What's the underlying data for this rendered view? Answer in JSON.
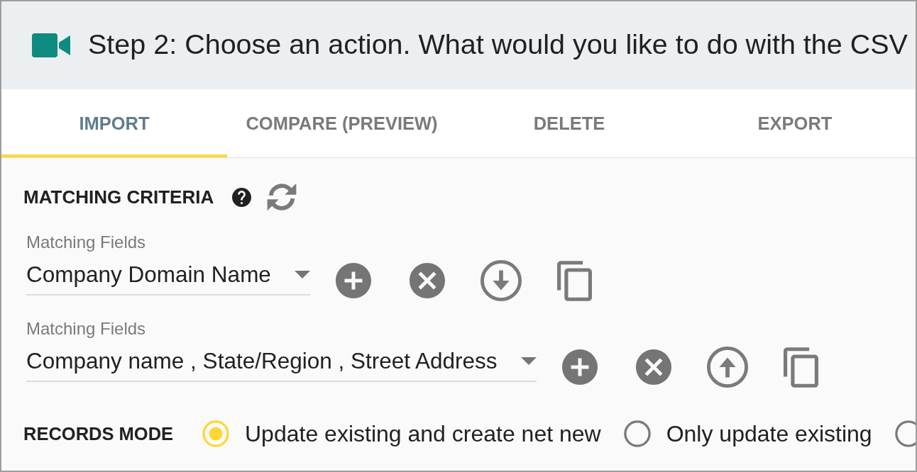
{
  "header": {
    "title": "Step 2: Choose an action. What would you like to do with the CSV"
  },
  "tabs": [
    {
      "label": "IMPORT",
      "selected": true
    },
    {
      "label": "COMPARE (PREVIEW)",
      "selected": false
    },
    {
      "label": "DELETE",
      "selected": false
    },
    {
      "label": "EXPORT",
      "selected": false
    }
  ],
  "matching_criteria": {
    "title": "MATCHING CRITERIA",
    "rules": [
      {
        "label": "Matching Fields",
        "value": "Company Domain Name",
        "kind": "down"
      },
      {
        "label": "Matching Fields",
        "value": "Company name , State/Region , Street Address",
        "kind": "up"
      }
    ]
  },
  "records_mode": {
    "label": "RECORDS MODE",
    "options": [
      {
        "label": "Update existing and create net new",
        "selected": true
      },
      {
        "label": "Only update existing",
        "selected": false
      },
      {
        "selected": false
      }
    ]
  }
}
